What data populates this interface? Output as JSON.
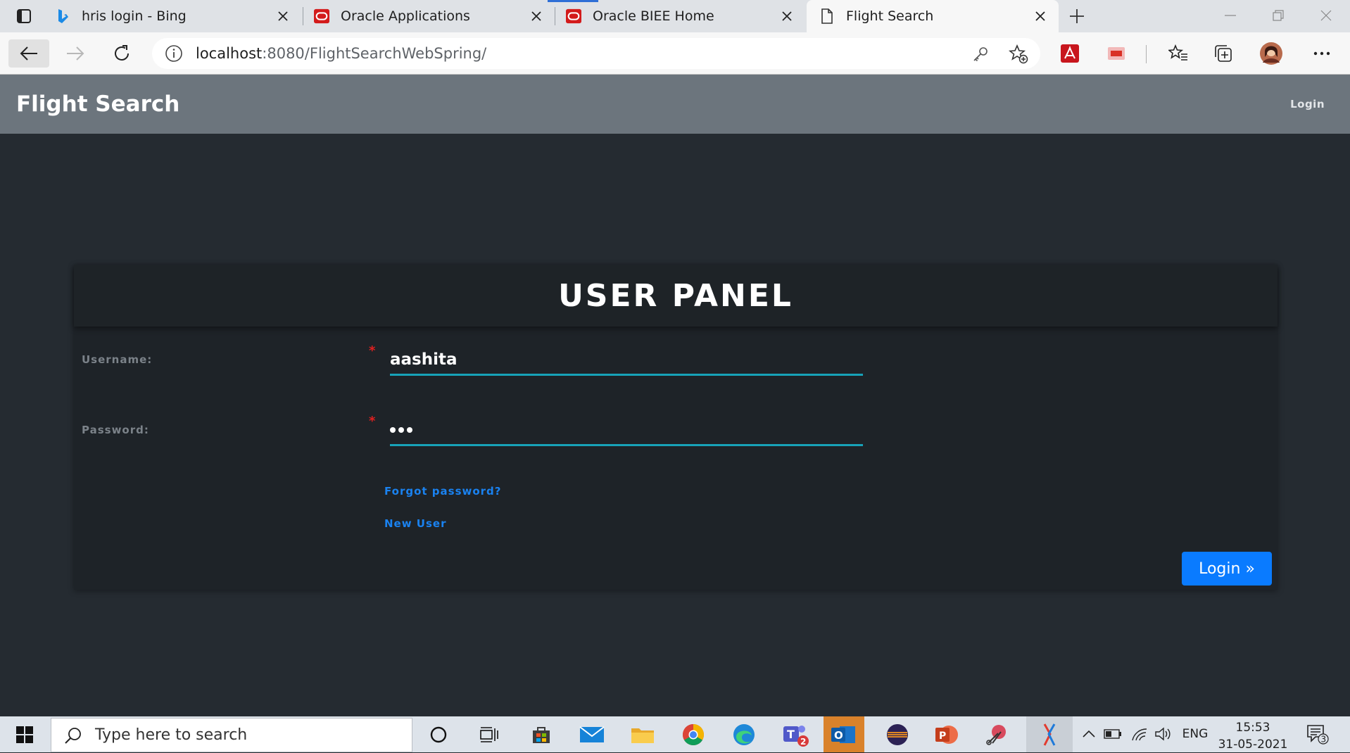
{
  "browser": {
    "tabs": [
      {
        "title": "hris login - Bing",
        "icon": "bing-icon",
        "active": false
      },
      {
        "title": "Oracle Applications",
        "icon": "oracle-icon",
        "active": false
      },
      {
        "title": "Oracle BIEE Home",
        "icon": "oracle-icon",
        "active": false
      },
      {
        "title": "Flight Search",
        "icon": "page-icon",
        "active": true
      }
    ],
    "address": {
      "host": "localhost",
      "path": ":8080/FlightSearchWebSpring/"
    }
  },
  "page": {
    "navbar": {
      "brand": "Flight Search",
      "login_link": "Login"
    },
    "panel": {
      "title": "USER PANEL",
      "username_label": "Username:",
      "username_value": "aashita",
      "password_label": "Password:",
      "required_mark": "*",
      "forgot_link": "Forgot password?",
      "new_user_link": "New User",
      "login_button": "Login »"
    }
  },
  "taskbar": {
    "search_placeholder": "Type here to search",
    "language": "ENG",
    "time": "15:53",
    "date": "31-05-2021",
    "teams_badge": "2",
    "notifications_badge": "3"
  },
  "colors": {
    "navbar": "#6c757d",
    "page_bg": "#252b31",
    "panel_bg": "#1e2328",
    "field_underline": "#17a2b8",
    "link": "#1a82f0",
    "button": "#0a7bff",
    "required": "#e02020"
  }
}
